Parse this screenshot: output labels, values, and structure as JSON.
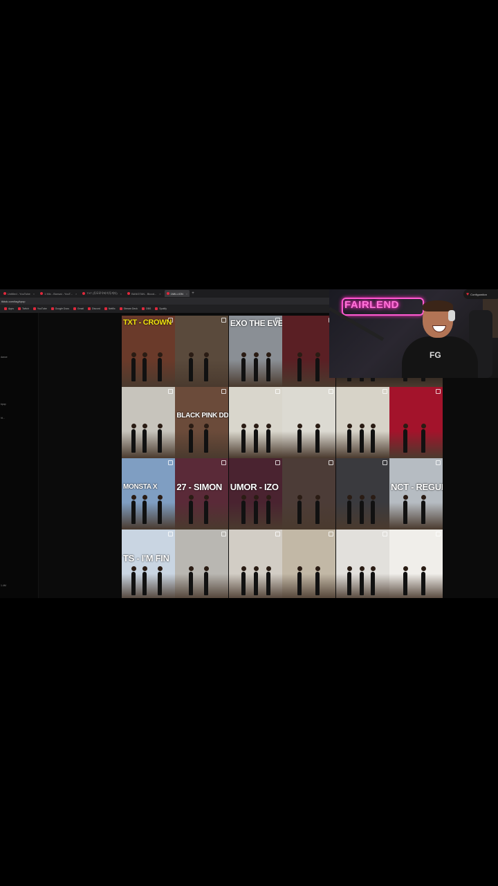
{
  "browser": {
    "tabs": [
      {
        "label": "Untitled - YouTube",
        "active": false
      },
      {
        "label": "1 Mix - Bonsai - YouT...",
        "active": false
      },
      {
        "label": "TXT (투모로우바이투게더)",
        "active": false
      },
      {
        "label": "BANGTAN - Blood...",
        "active": false
      },
      {
        "label": "1MILLION",
        "active": true
      }
    ],
    "new_tab": "+",
    "address": "tiktok.com/tag/kpop",
    "bookmarks": [
      "Apps",
      "Twitch",
      "YouTube",
      "Google Docs",
      "Gmail",
      "Discord",
      "Netflix",
      "Stream Deck",
      "OBS",
      "Spotify"
    ]
  },
  "sidebar": {
    "texts": [
      "dance",
      "kpop",
      "ht...",
      "1.4M"
    ]
  },
  "grid": {
    "cells": [
      {
        "overlay": "TXT - CROWN",
        "style": "yellow",
        "bg": "#6a3a2a"
      },
      {
        "overlay": "",
        "style": "",
        "bg": "#5a4a3c"
      },
      {
        "overlay": "EXO THE EVE",
        "style": "top",
        "bg": "#8a8f95"
      },
      {
        "overlay": "",
        "style": "",
        "bg": "#5a1f24"
      },
      {
        "overlay": "",
        "style": "",
        "bg": "#101010"
      },
      {
        "overlay": "",
        "style": "",
        "bg": "#101010"
      },
      {
        "overlay": "",
        "style": "",
        "bg": "#c7c4bc"
      },
      {
        "overlay": "BLACK PINK DDU-DU DDU",
        "style": "small",
        "bg": "#6b4b3a"
      },
      {
        "overlay": "",
        "style": "",
        "bg": "#d9d6cc"
      },
      {
        "overlay": "",
        "style": "",
        "bg": "#dcdad2"
      },
      {
        "overlay": "",
        "style": "",
        "bg": "#d7d3c8"
      },
      {
        "overlay": "",
        "style": "",
        "bg": "#a3132b"
      },
      {
        "overlay": "MONSTA X",
        "style": "small",
        "bg": "#7f9ec2"
      },
      {
        "overlay": "27 - SIMON",
        "style": "",
        "bg": "#5a2a38"
      },
      {
        "overlay": "UMOR - IZO",
        "style": "",
        "bg": "#4a2330"
      },
      {
        "overlay": "",
        "style": "",
        "bg": "#4c3c37"
      },
      {
        "overlay": "",
        "style": "",
        "bg": "#3a3a3e"
      },
      {
        "overlay": "NCT - REGULA",
        "style": "",
        "bg": "#b6bcc2"
      },
      {
        "overlay": "TS - I'M FIN",
        "style": "",
        "bg": "#c9d5e2"
      },
      {
        "overlay": "",
        "style": "",
        "bg": "#b9b7b2"
      },
      {
        "overlay": "",
        "style": "",
        "bg": "#d2cdc5"
      },
      {
        "overlay": "",
        "style": "",
        "bg": "#c2b8a6"
      },
      {
        "overlay": "",
        "style": "",
        "bg": "#e2e0dc"
      },
      {
        "overlay": "",
        "style": "",
        "bg": "#f0eeea"
      },
      {
        "overlay": "",
        "style": "",
        "bg": "#e8e6e2"
      },
      {
        "overlay": "",
        "style": "",
        "bg": "#e4e2de"
      },
      {
        "overlay": "",
        "style": "",
        "bg": "#e6e4e0"
      },
      {
        "overlay": "",
        "style": "",
        "bg": "#101014"
      },
      {
        "overlay": "",
        "style": "",
        "bg": "#0d0d12"
      },
      {
        "overlay": "",
        "style": "",
        "bg": "#1a2030"
      }
    ]
  },
  "webcam": {
    "neon_sign": "FAIRLEND",
    "shirt_text": "FG"
  },
  "chat_chip": {
    "icon": "heart-icon",
    "text": "Configuration"
  }
}
